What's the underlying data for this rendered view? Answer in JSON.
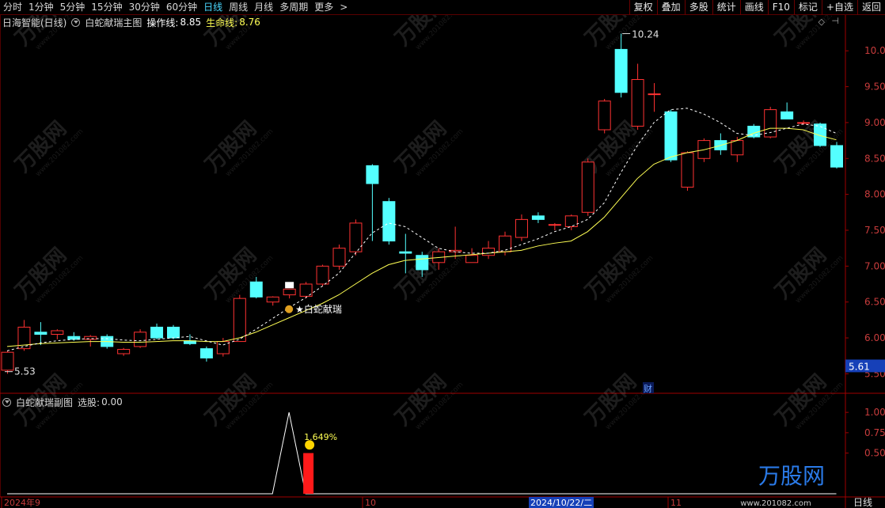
{
  "toolbar": {
    "periods": [
      "分时",
      "1分钟",
      "5分钟",
      "15分钟",
      "30分钟",
      "60分钟",
      "日线",
      "周线",
      "月线",
      "多周期",
      "更多"
    ],
    "active_period": "日线",
    "right_buttons": [
      "复权",
      "叠加",
      "多股",
      "统计",
      "画线",
      "F10",
      "标记",
      "+自选",
      "返回"
    ]
  },
  "main_title": {
    "stock": "日海智能(日线)",
    "indicator": "白蛇献瑞主图",
    "op_line_label": "操作线:",
    "op_line_value": "8.85",
    "life_line_label": "生命线:",
    "life_line_value": "8.76"
  },
  "sub_title": {
    "indicator": "白蛇献瑞副图",
    "select_label": "选股:",
    "select_value": "0.00"
  },
  "annotations": {
    "signal_label": "白蛇献瑞",
    "high_label": "10.24",
    "low_label": "5.53",
    "current_price": "5.61",
    "cai_label": "财",
    "sub_pct": "1.649%"
  },
  "x_axis": {
    "labels": [
      "2024年9",
      "10",
      "2024/10/22/二",
      "11",
      "日线"
    ]
  },
  "watermark": {
    "brand": "万股网",
    "url": "www.201082.com"
  },
  "colors": {
    "up": "#ff3232",
    "down": "#54ffff",
    "op_line": "#ffffff",
    "life_line": "#ffff54",
    "axis_red": "#a00000"
  },
  "chart_data": [
    {
      "type": "candlestick",
      "title": "白蛇献瑞主图",
      "ylim": [
        5.35,
        10.3
      ],
      "y_ticks": [
        5.5,
        6.0,
        6.5,
        7.0,
        7.5,
        8.0,
        8.5,
        9.0,
        9.5,
        10.0
      ],
      "candles": [
        {
          "o": 5.55,
          "h": 5.82,
          "l": 5.5,
          "c": 5.8
        },
        {
          "o": 5.85,
          "h": 6.25,
          "l": 5.82,
          "c": 6.15
        },
        {
          "o": 6.08,
          "h": 6.22,
          "l": 5.9,
          "c": 6.05
        },
        {
          "o": 6.05,
          "h": 6.12,
          "l": 5.98,
          "c": 6.1
        },
        {
          "o": 6.02,
          "h": 6.08,
          "l": 5.96,
          "c": 5.98
        },
        {
          "o": 5.98,
          "h": 6.04,
          "l": 5.88,
          "c": 6.02
        },
        {
          "o": 6.02,
          "h": 6.05,
          "l": 5.85,
          "c": 5.88
        },
        {
          "o": 5.78,
          "h": 5.86,
          "l": 5.75,
          "c": 5.84
        },
        {
          "o": 5.88,
          "h": 6.12,
          "l": 5.86,
          "c": 6.08
        },
        {
          "o": 6.15,
          "h": 6.2,
          "l": 5.98,
          "c": 6.0
        },
        {
          "o": 6.15,
          "h": 6.18,
          "l": 5.98,
          "c": 6.0
        },
        {
          "o": 5.96,
          "h": 6.05,
          "l": 5.9,
          "c": 5.92
        },
        {
          "o": 5.85,
          "h": 5.88,
          "l": 5.67,
          "c": 5.72
        },
        {
          "o": 5.78,
          "h": 6.0,
          "l": 5.74,
          "c": 5.95
        },
        {
          "o": 5.95,
          "h": 6.6,
          "l": 5.95,
          "c": 6.55
        },
        {
          "o": 6.78,
          "h": 6.85,
          "l": 6.55,
          "c": 6.57
        },
        {
          "o": 6.5,
          "h": 6.58,
          "l": 6.45,
          "c": 6.57
        },
        {
          "o": 6.6,
          "h": 6.68,
          "l": 6.55,
          "c": 6.68
        },
        {
          "o": 6.58,
          "h": 6.78,
          "l": 6.55,
          "c": 6.75
        },
        {
          "o": 6.75,
          "h": 7.02,
          "l": 6.72,
          "c": 7.0
        },
        {
          "o": 7.0,
          "h": 7.3,
          "l": 6.95,
          "c": 7.25
        },
        {
          "o": 7.2,
          "h": 7.65,
          "l": 7.15,
          "c": 7.6
        },
        {
          "o": 8.4,
          "h": 8.42,
          "l": 7.35,
          "c": 8.15
        },
        {
          "o": 7.9,
          "h": 7.95,
          "l": 7.3,
          "c": 7.35
        },
        {
          "o": 7.2,
          "h": 7.45,
          "l": 6.9,
          "c": 7.18
        },
        {
          "o": 7.15,
          "h": 7.2,
          "l": 6.85,
          "c": 6.95
        },
        {
          "o": 7.05,
          "h": 7.25,
          "l": 6.95,
          "c": 7.2
        },
        {
          "o": 7.2,
          "h": 7.55,
          "l": 7.1,
          "c": 7.22
        },
        {
          "o": 7.05,
          "h": 7.25,
          "l": 7.05,
          "c": 7.15
        },
        {
          "o": 7.15,
          "h": 7.35,
          "l": 7.1,
          "c": 7.25
        },
        {
          "o": 7.2,
          "h": 7.48,
          "l": 7.15,
          "c": 7.42
        },
        {
          "o": 7.4,
          "h": 7.72,
          "l": 7.35,
          "c": 7.65
        },
        {
          "o": 7.7,
          "h": 7.75,
          "l": 7.6,
          "c": 7.65
        },
        {
          "o": 7.58,
          "h": 7.6,
          "l": 7.5,
          "c": 7.58
        },
        {
          "o": 7.55,
          "h": 7.72,
          "l": 7.5,
          "c": 7.7
        },
        {
          "o": 7.75,
          "h": 8.5,
          "l": 7.7,
          "c": 8.45
        },
        {
          "o": 8.9,
          "h": 9.33,
          "l": 8.85,
          "c": 9.3
        },
        {
          "o": 10.02,
          "h": 10.24,
          "l": 9.35,
          "c": 9.42
        },
        {
          "o": 8.95,
          "h": 9.82,
          "l": 8.9,
          "c": 9.6
        },
        {
          "o": 9.4,
          "h": 9.55,
          "l": 9.15,
          "c": 9.4
        },
        {
          "o": 9.15,
          "h": 9.18,
          "l": 8.45,
          "c": 8.48
        },
        {
          "o": 8.1,
          "h": 8.6,
          "l": 8.05,
          "c": 8.58
        },
        {
          "o": 8.5,
          "h": 8.78,
          "l": 8.45,
          "c": 8.75
        },
        {
          "o": 8.75,
          "h": 8.85,
          "l": 8.55,
          "c": 8.62
        },
        {
          "o": 8.55,
          "h": 8.8,
          "l": 8.45,
          "c": 8.75
        },
        {
          "o": 8.95,
          "h": 8.98,
          "l": 8.78,
          "c": 8.8
        },
        {
          "o": 8.8,
          "h": 9.22,
          "l": 8.78,
          "c": 9.18
        },
        {
          "o": 9.15,
          "h": 9.28,
          "l": 9.05,
          "c": 9.05
        },
        {
          "o": 9.0,
          "h": 9.03,
          "l": 8.97,
          "c": 9.0
        },
        {
          "o": 8.98,
          "h": 9.0,
          "l": 8.66,
          "c": 8.68
        },
        {
          "o": 8.68,
          "h": 8.73,
          "l": 8.36,
          "c": 8.38
        }
      ],
      "series": [
        {
          "name": "操作线",
          "values": [
            5.82,
            5.88,
            5.93,
            5.96,
            5.98,
            5.99,
            5.99,
            5.97,
            5.96,
            5.98,
            6.0,
            6.02,
            5.96,
            5.9,
            5.98,
            6.12,
            6.27,
            6.42,
            6.56,
            6.72,
            6.9,
            7.18,
            7.46,
            7.6,
            7.55,
            7.4,
            7.25,
            7.2,
            7.18,
            7.18,
            7.22,
            7.3,
            7.38,
            7.48,
            7.55,
            7.65,
            7.88,
            8.3,
            8.68,
            9.0,
            9.18,
            9.2,
            9.12,
            9.0,
            8.85,
            8.82,
            8.86,
            8.92,
            8.98,
            8.95,
            8.85
          ]
        },
        {
          "name": "生命线",
          "values": [
            5.88,
            5.9,
            5.92,
            5.93,
            5.94,
            5.95,
            5.95,
            5.94,
            5.94,
            5.95,
            5.96,
            5.96,
            5.95,
            5.95,
            6.0,
            6.08,
            6.18,
            6.28,
            6.38,
            6.48,
            6.6,
            6.75,
            6.9,
            7.02,
            7.08,
            7.1,
            7.12,
            7.14,
            7.16,
            7.18,
            7.2,
            7.22,
            7.28,
            7.32,
            7.35,
            7.48,
            7.68,
            7.95,
            8.22,
            8.42,
            8.52,
            8.58,
            8.62,
            8.68,
            8.75,
            8.85,
            8.92,
            8.92,
            8.9,
            8.82,
            8.76
          ]
        }
      ]
    },
    {
      "type": "line",
      "title": "白蛇献瑞副图",
      "ylim": [
        0,
        1.05
      ],
      "y_ticks": [
        0.5,
        0.75,
        1.0
      ],
      "series": [
        {
          "name": "选股",
          "values": [
            0,
            0,
            0,
            0,
            0,
            0,
            0,
            0,
            0,
            0,
            0,
            0,
            0,
            0,
            0,
            0,
            0,
            1.0,
            0,
            0,
            0,
            0,
            0,
            0,
            0,
            0,
            0,
            0,
            0,
            0,
            0,
            0,
            0,
            0,
            0,
            0,
            0,
            0,
            0,
            0,
            0,
            0,
            0,
            0,
            0,
            0,
            0,
            0,
            0,
            0,
            0
          ]
        }
      ],
      "bars": [
        {
          "index": 18,
          "value": 0.5
        }
      ]
    }
  ]
}
